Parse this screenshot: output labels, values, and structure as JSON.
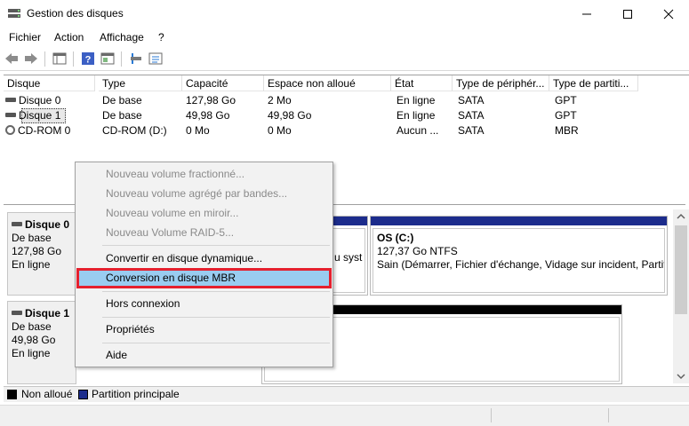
{
  "window": {
    "title": "Gestion des disques",
    "minimize_glyph": "—",
    "maximize_glyph": "☐",
    "close_glyph": "✕"
  },
  "menu": [
    {
      "label": "Fichier"
    },
    {
      "label": "Action"
    },
    {
      "label": "Affichage"
    },
    {
      "label": "?"
    }
  ],
  "toolbar_icons": [
    "back-icon",
    "forward-icon",
    "list-view-icon",
    "help-icon",
    "console-icon",
    "rescan-icon",
    "properties-icon"
  ],
  "columns": [
    "Disque",
    "Type",
    "Capacité",
    "Espace non alloué",
    "État",
    "Type de périphér...",
    "Type de partiti..."
  ],
  "disks": [
    {
      "name": "Disque 0",
      "type": "De base",
      "capacity": "127,98 Go",
      "unallocated": "2 Mo",
      "state": "En ligne",
      "device": "SATA",
      "partition": "GPT",
      "icon": "disk-icon"
    },
    {
      "name": "Disque 1",
      "type": "De base",
      "capacity": "49,98 Go",
      "unallocated": "49,98 Go",
      "state": "En ligne",
      "device": "SATA",
      "partition": "GPT",
      "icon": "disk-icon"
    },
    {
      "name": "CD-ROM 0",
      "type": "CD-ROM (D:)",
      "capacity": "0 Mo",
      "unallocated": "0 Mo",
      "state": "Aucun ...",
      "device": "SATA",
      "partition": "MBR",
      "icon": "cdrom-icon"
    }
  ],
  "graph": {
    "disk0": {
      "name": "Disque 0",
      "type": "De base",
      "size": "127,98 Go",
      "state": "En ligne",
      "partial_text": "u syst",
      "os_partition": {
        "title": "OS  (C:)",
        "size": "127,37 Go NTFS",
        "status": "Sain (Démarrer, Fichier d'échange, Vidage sur incident, Partiti"
      }
    },
    "disk1": {
      "name": "Disque 1",
      "type": "De base",
      "size": "49,98 Go",
      "state": "En ligne"
    }
  },
  "legend": {
    "unallocated": "Non alloué",
    "primary": "Partition principale",
    "unallocated_color": "#000000",
    "primary_color": "#1c2c8c"
  },
  "context_menu": {
    "items": [
      {
        "label": "Nouveau volume fractionné...",
        "enabled": false
      },
      {
        "label": "Nouveau volume agrégé par bandes...",
        "enabled": false
      },
      {
        "label": "Nouveau volume en miroir...",
        "enabled": false
      },
      {
        "label": "Nouveau Volume RAID-5...",
        "enabled": false
      },
      {
        "label": "Convertir en disque dynamique...",
        "enabled": true
      },
      {
        "label": "Conversion en disque MBR",
        "enabled": true,
        "highlighted": true
      },
      {
        "label": "Hors connexion",
        "enabled": true
      },
      {
        "label": "Propriétés",
        "enabled": true
      },
      {
        "label": "Aide",
        "enabled": true
      }
    ]
  },
  "colors": {
    "partition_bar": "#1c2c8c",
    "highlight": "#99ccf0",
    "annotation_box": "#e5202e"
  }
}
